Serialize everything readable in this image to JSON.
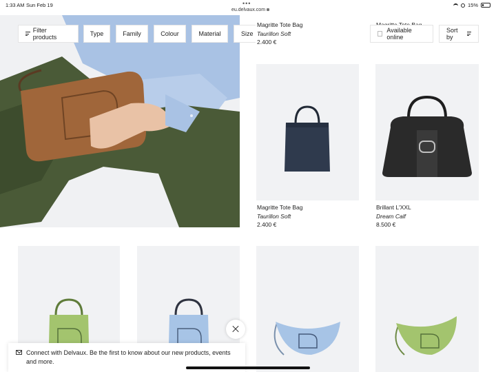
{
  "status_bar": {
    "time": "1:33 AM",
    "date": "Sun Feb 19",
    "url": "eu.delvaux.com",
    "battery": "15%"
  },
  "filters": {
    "filter_products": "Filter products",
    "type": "Type",
    "family": "Family",
    "colour": "Colour",
    "material": "Material",
    "size": "Size",
    "available_online": "Available online",
    "sort_by": "Sort by"
  },
  "products": [
    {
      "name": "Magritte Tote Bag",
      "material": "Taurillon Soft",
      "price": "2.400 €"
    },
    {
      "name": "Magritte Tote Bag",
      "material": "",
      "price": ""
    },
    {
      "name": "Magritte Tote Bag",
      "material": "Taurillon Soft",
      "price": "2.400 €"
    },
    {
      "name": "Brillant L'XXL",
      "material": "Dream Calf",
      "price": "8.500 €"
    }
  ],
  "newsletter": {
    "text": "Connect with Delvaux. Be the first to know about our new products, events and more."
  },
  "icons": {
    "filter": "filter-lines-icon",
    "sort": "sort-lines-icon",
    "mail": "mail-icon",
    "close": "close-icon"
  },
  "colors": {
    "tile_bg": "#f1f2f4",
    "navy_bag": "#2f3a4d",
    "black_bag": "#2a2a2a",
    "green_bag": "#a3c46e",
    "blue_bag": "#a7c4e6",
    "tan_bag": "#a0663a"
  }
}
